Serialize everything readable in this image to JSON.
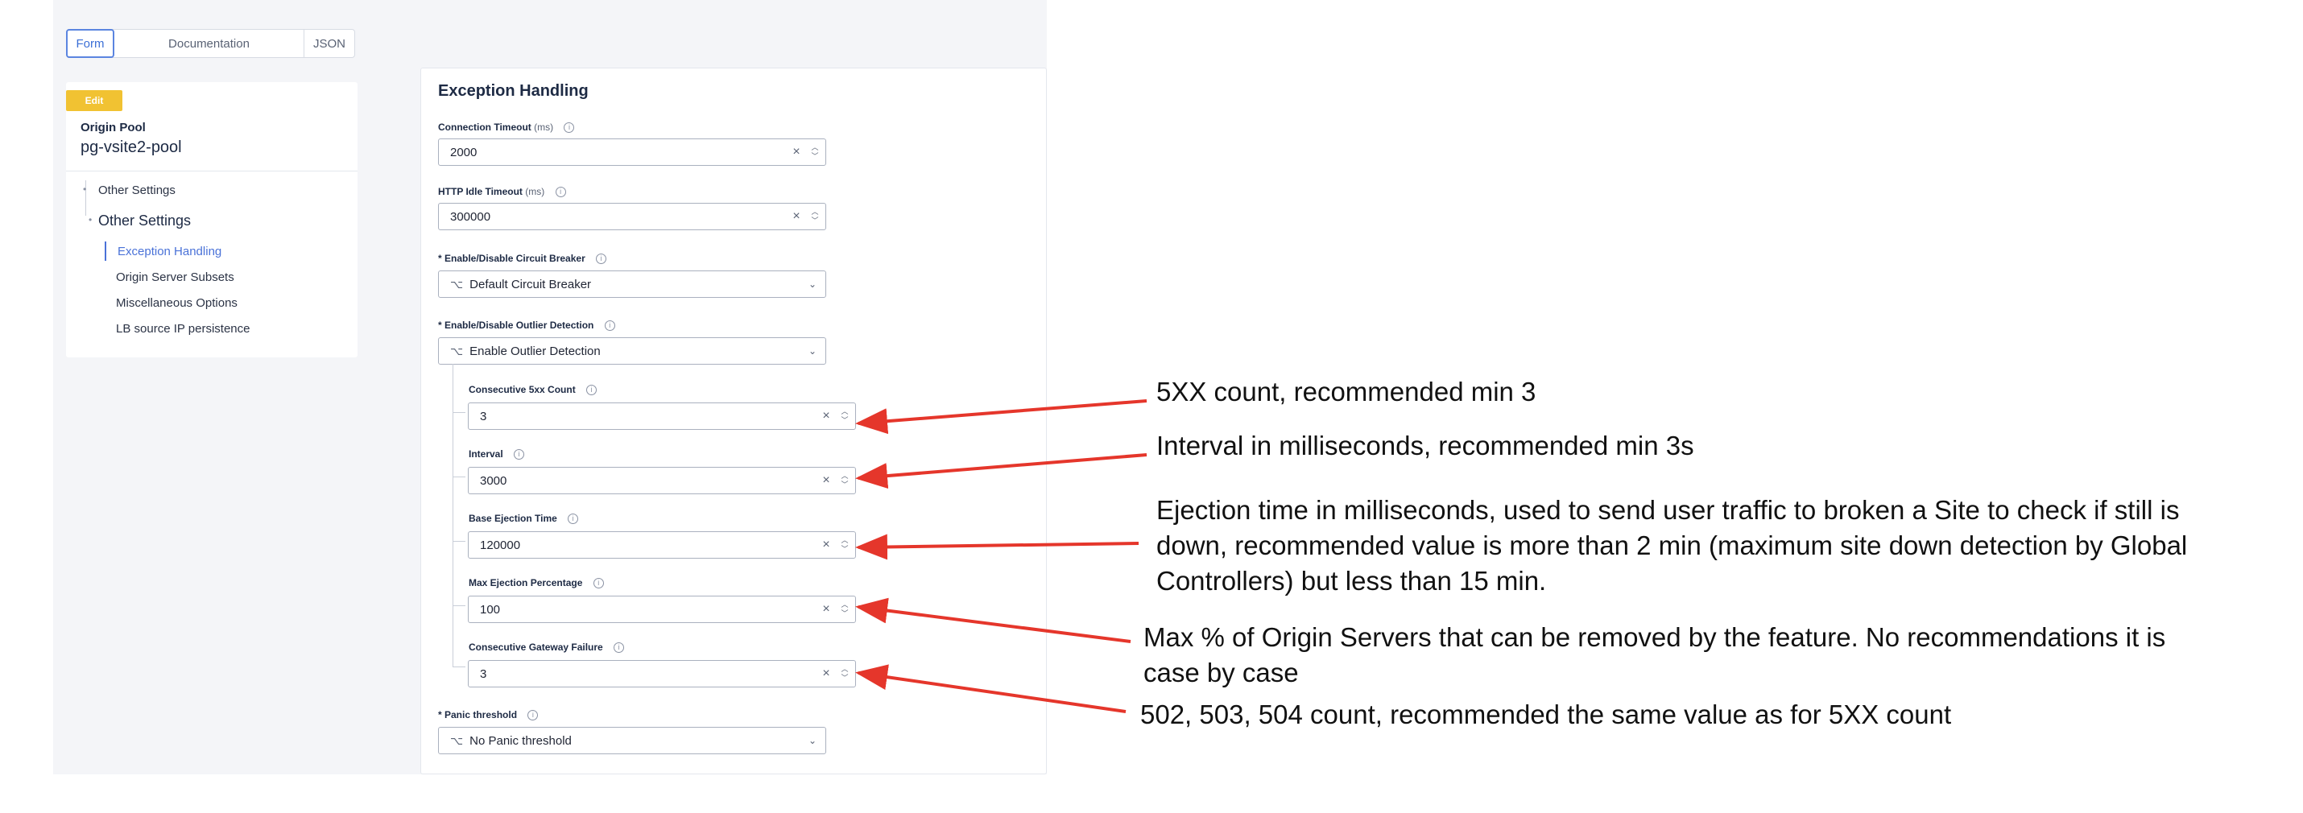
{
  "tabs": [
    {
      "label": "Form",
      "active": true
    },
    {
      "label": "Documentation",
      "active": false
    },
    {
      "label": "JSON",
      "active": false
    }
  ],
  "sidebar": {
    "badge": "Edit",
    "object_type": "Origin Pool",
    "object_name": "pg-vsite2-pool",
    "items": [
      {
        "label": "Other Settings"
      },
      {
        "label": "Other Settings"
      },
      {
        "label": "Exception Handling"
      },
      {
        "label": "Origin Server Subsets"
      },
      {
        "label": "Miscellaneous Options"
      },
      {
        "label": "LB source IP persistence"
      }
    ]
  },
  "section": {
    "title": "Exception Handling",
    "connection_timeout": {
      "label": "Connection Timeout",
      "unit": "(ms)",
      "value": "2000"
    },
    "http_idle_timeout": {
      "label": "HTTP Idle Timeout",
      "unit": "(ms)",
      "value": "300000"
    },
    "circuit_breaker": {
      "label": "* Enable/Disable Circuit Breaker",
      "value": "Default Circuit Breaker"
    },
    "outlier_detection": {
      "label": "* Enable/Disable Outlier Detection",
      "value": "Enable Outlier Detection"
    },
    "consecutive_5xx": {
      "label": "Consecutive 5xx Count",
      "value": "3"
    },
    "interval": {
      "label": "Interval",
      "value": "3000"
    },
    "base_ejection_time": {
      "label": "Base Ejection Time",
      "value": "120000"
    },
    "max_ejection_percentage": {
      "label": "Max Ejection Percentage",
      "value": "100"
    },
    "consecutive_gateway_failure": {
      "label": "Consecutive Gateway Failure",
      "value": "3"
    },
    "panic_threshold": {
      "label": "* Panic threshold",
      "value": "No Panic threshold"
    }
  },
  "annotations": {
    "a1": "5XX count, recommended min 3",
    "a2": "Interval in milliseconds, recommended min 3s",
    "a3_line1": "Ejection time in milliseconds, used to send user traffic to broken a Site to check if still is",
    "a3_line2": "down, recommended value is more than 2 min (maximum site down detection by Global",
    "a3_line3": "Controllers) but less than 15 min.",
    "a4_line1": "Max % of Origin Servers that can be removed by the feature. No recommendations it is",
    "a4_line2": "case by case",
    "a5": "502, 503, 504 count, recommended the same value as for 5XX count"
  },
  "colors": {
    "arrow": "#e5362b",
    "accent": "#4a72d8",
    "badge": "#f1c232"
  },
  "icons": {
    "info": "info-icon",
    "clear": "clear-icon",
    "spinner": "stepper-icon",
    "select": "select-icon",
    "chevron": "chevron-down-icon"
  }
}
